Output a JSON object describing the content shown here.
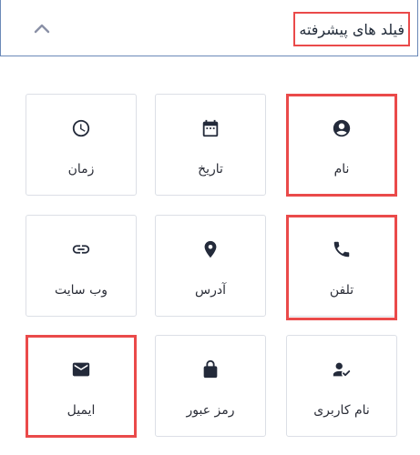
{
  "header": {
    "title": "فیلد های پیشرفته",
    "toggle_icon": "chevron-up-icon"
  },
  "fields": [
    {
      "label": "نام",
      "icon": "account-circle-icon",
      "highlighted": true
    },
    {
      "label": "تاریخ",
      "icon": "calendar-icon",
      "highlighted": false
    },
    {
      "label": "زمان",
      "icon": "clock-icon",
      "highlighted": false
    },
    {
      "label": "تلفن",
      "icon": "phone-icon",
      "highlighted": true
    },
    {
      "label": "آدرس",
      "icon": "location-pin-icon",
      "highlighted": false
    },
    {
      "label": "وب سایت",
      "icon": "link-icon",
      "highlighted": false
    },
    {
      "label": "نام کاربری",
      "icon": "user-check-icon",
      "highlighted": false
    },
    {
      "label": "رمز عبور",
      "icon": "lock-icon",
      "highlighted": false
    },
    {
      "label": "ایمیل",
      "icon": "email-icon",
      "highlighted": true
    }
  ],
  "colors": {
    "highlight": "#ea4a4a",
    "icon": "#232a3a",
    "card_border": "#dcdfe6",
    "header_border": "#6b89b8"
  }
}
